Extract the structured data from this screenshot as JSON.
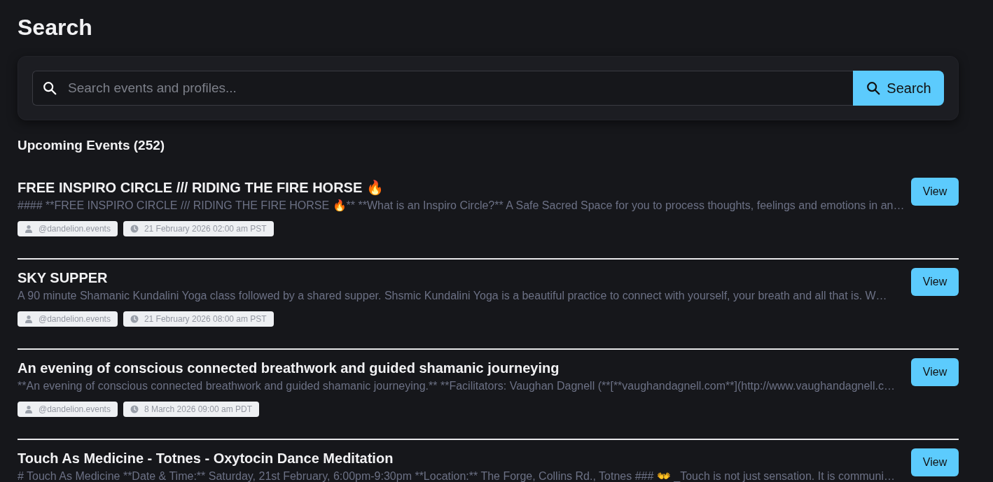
{
  "page_title": "Search",
  "search": {
    "placeholder": "Search events and profiles...",
    "button": "Search"
  },
  "section_heading": "Upcoming Events (252)",
  "events": [
    {
      "title": "FREE INSPIRO CIRCLE /// RIDING THE FIRE HORSE 🔥",
      "description": "#### **FREE INSPIRO CIRCLE /// RIDING THE FIRE HORSE 🔥** **What is an Inspiro Circle?** A Safe Sacred Space for you to process thoughts, feelings and emotions in an…",
      "organizer": "@dandelion.events",
      "date": "21 February 2026 02:00 am PST",
      "button": "View"
    },
    {
      "title": "SKY SUPPER",
      "description": "A 90 minute Shamanic Kundalini Yoga class followed by a shared supper. Shsmic Kundalini Yoga is a beautiful practice to connect with yourself, your breath and all that is. W…",
      "organizer": "@dandelion.events",
      "date": "21 February 2026 08:00 am PST",
      "button": "View"
    },
    {
      "title": "An evening of conscious connected breathwork and guided shamanic journeying",
      "description": "**An evening of conscious connected breathwork and guided shamanic journeying.** **Facilitators: Vaughan Dagnell (**[**vaughandagnell.com**](http://www.vaughandagnell.c…",
      "organizer": "@dandelion.events",
      "date": "8 March 2026 09:00 am PDT",
      "button": "View"
    },
    {
      "title": "Touch As Medicine - Totnes - Oxytocin Dance Meditation",
      "description": "# Touch As Medicine **Date & Time:** Saturday, 21st February, 6:00pm-9:30pm **Location:** The Forge, Collins Rd., Totnes ### 👐 _Touch is not just sensation. It is communi…",
      "button": "View"
    }
  ]
}
